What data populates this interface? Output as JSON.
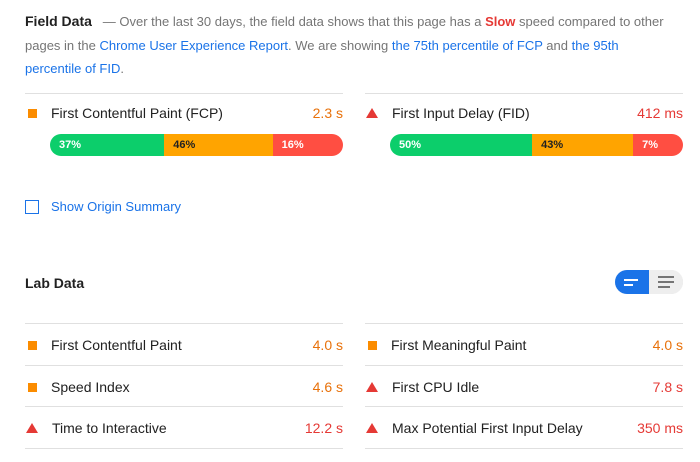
{
  "field_data": {
    "title": "Field Data",
    "dash": "—",
    "text_1": "Over the last 30 days, the field data shows that this page has a",
    "speed_label": "Slow",
    "text_2": "speed compared to other pages in the",
    "report_link": "Chrome User Experience Report",
    "text_3": ". We are showing",
    "fcp_link": "the 75th percentile of FCP",
    "text_4": "and",
    "fid_link": "the 95th percentile of FID",
    "text_5": ".",
    "metrics": [
      {
        "label": "First Contentful Paint (FCP)",
        "value": "2.3 s",
        "icon": "orange-square-icon",
        "distribution": [
          {
            "label": "37%",
            "percent": 37
          },
          {
            "label": "46%",
            "percent": 46
          },
          {
            "label": "16%",
            "percent": 16
          }
        ]
      },
      {
        "label": "First Input Delay (FID)",
        "value": "412 ms",
        "icon": "red-triangle-icon",
        "distribution": [
          {
            "label": "50%",
            "percent": 50
          },
          {
            "label": "43%",
            "percent": 43
          },
          {
            "label": "7%",
            "percent": 7
          }
        ]
      }
    ]
  },
  "origin_summary": {
    "label": "Show Origin Summary",
    "checked": false
  },
  "lab_data": {
    "title": "Lab Data",
    "toggle": {
      "active": "bars-view-icon",
      "inactive": "list-view-icon"
    },
    "metrics": [
      {
        "label": "First Contentful Paint",
        "value": "4.0 s",
        "icon": "orange-square-icon"
      },
      {
        "label": "First Meaningful Paint",
        "value": "4.0 s",
        "icon": "orange-square-icon"
      },
      {
        "label": "Speed Index",
        "value": "4.6 s",
        "icon": "orange-square-icon"
      },
      {
        "label": "First CPU Idle",
        "value": "7.8 s",
        "icon": "red-triangle-icon"
      },
      {
        "label": "Time to Interactive",
        "value": "12.2 s",
        "icon": "red-triangle-icon"
      },
      {
        "label": "Max Potential First Input Delay",
        "value": "350 ms",
        "icon": "red-triangle-icon"
      }
    ]
  },
  "colors": {
    "good": "#0cce6b",
    "average": "#ffa400",
    "poor": "#ff4e42",
    "link": "#1a73e8"
  }
}
